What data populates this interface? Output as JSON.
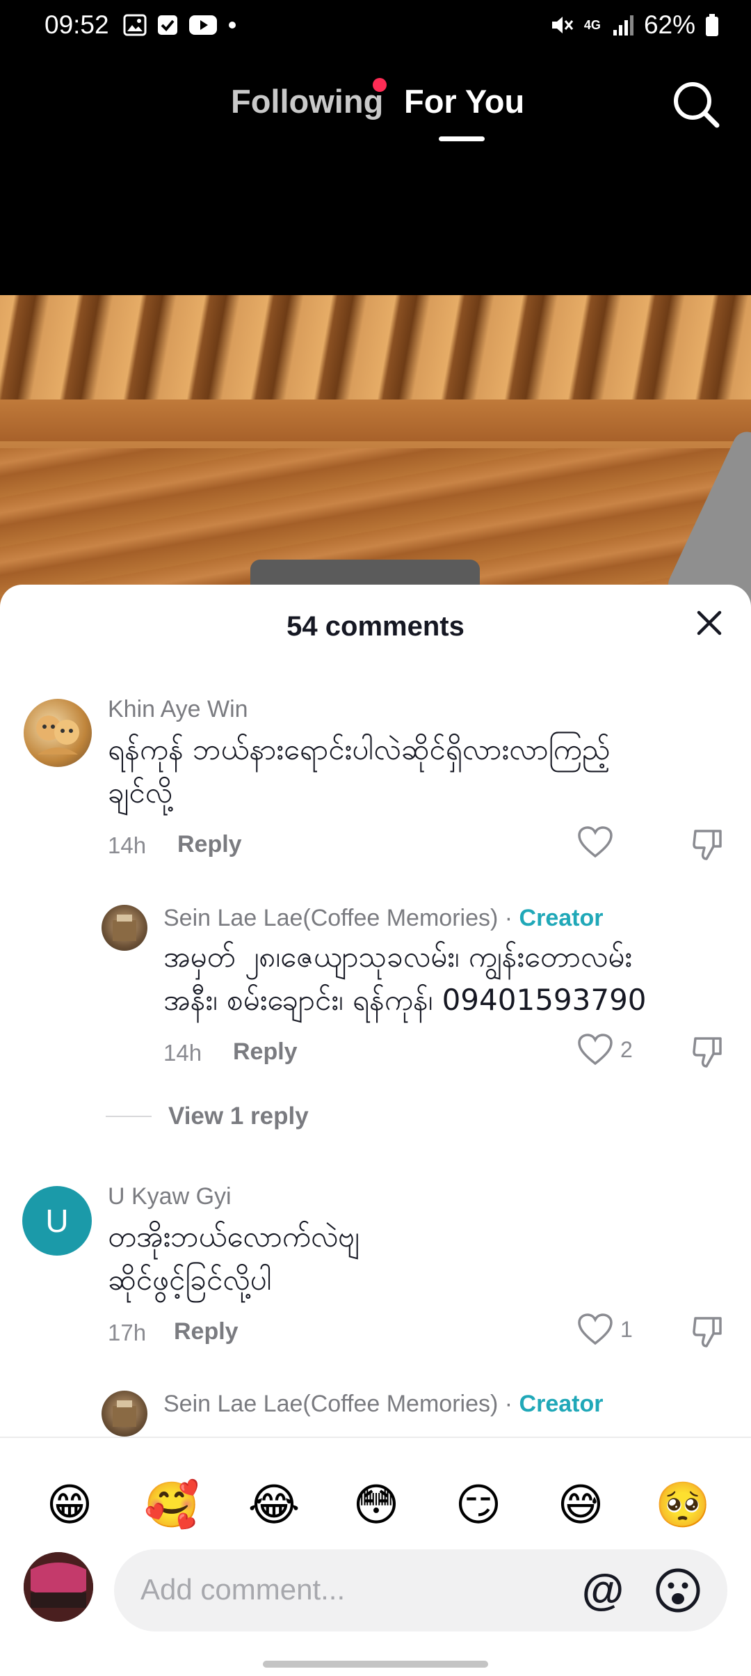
{
  "status_bar": {
    "time": "09:52",
    "battery": "62%",
    "network": "4G",
    "icons": [
      "image-icon",
      "checkbox-icon",
      "youtube-icon",
      "dot-icon",
      "mute-icon",
      "network-icon",
      "signal-icon",
      "battery-icon"
    ]
  },
  "nav": {
    "following": "Following",
    "for_you": "For You",
    "search_icon": "search-icon"
  },
  "sheet": {
    "title": "54 comments",
    "close_icon": "close-icon"
  },
  "comments": [
    {
      "user": "Khin Aye Win",
      "text_line1": "ရန်ကုန် ဘယ်နားရောင်းပါလဲဆိုင်ရှိလားလာကြည့်",
      "text_line2": "ချင်လို့",
      "time": "14h",
      "reply": "Reply",
      "likes": ""
    },
    {
      "user": "Sein Lae Lae(Coffee Memories)",
      "separator": "·",
      "badge": "Creator",
      "text_line1": "အမှတ် ၂၈၊ဇေယျာသုခလမ်း၊ ကျွန်းတောလမ်း",
      "text_line2": "အနီး၊ စမ်းချောင်း၊ ရန်ကုန်၊ 09401593790",
      "time": "14h",
      "reply": "Reply",
      "likes": "2"
    },
    {
      "user": "U Kyaw Gyi",
      "avatar_letter": "U",
      "text_line1": "တအိုးဘယ်လောက်လဲဗျ",
      "text_line2": "ဆိုင်ဖွင့်ခြင်လို့ပါ",
      "time": "17h",
      "reply": "Reply",
      "likes": "1"
    },
    {
      "user": "Sein Lae Lae(Coffee Memories)",
      "separator": "·",
      "badge": "Creator"
    }
  ],
  "view_reply": "View 1 reply",
  "emojis": [
    "😁",
    "🥰",
    "😂",
    "😳",
    "😏",
    "😅",
    "🥺"
  ],
  "composer": {
    "placeholder": "Add comment...",
    "at": "@"
  },
  "colors": {
    "accent_red": "#fe2c55",
    "creator_teal": "#20a8b8",
    "avatar_teal": "#1b9aa9"
  }
}
